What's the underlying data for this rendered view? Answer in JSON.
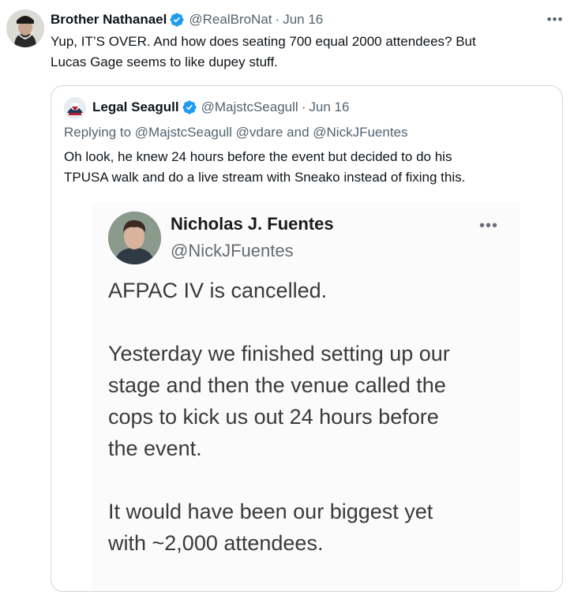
{
  "outer": {
    "author_name": "Brother Nathanael",
    "handle": "@RealBroNat",
    "separator": "·",
    "date": "Jun 16",
    "more_icon": "more-horizontal-icon",
    "text_line1": "Yup, IT’S OVER. And how  does seating 700 equal 2000 attendees? But",
    "text_line2": "Lucas Gage seems to like dupey stuff."
  },
  "quote": {
    "author_name": "Legal Seagull",
    "handle": "@MajstcSeagull",
    "separator": "·",
    "date": "Jun 16",
    "replying_prefix": "Replying to",
    "mention1": "@MajstcSeagull",
    "mention2": "@vdare",
    "mention_and": "and",
    "mention3": "@NickJFuentes",
    "text_line1": "Oh look, he knew 24 hours before the event but decided to do his",
    "text_line2": "TPUSA walk and do a live stream with Sneako instead of fixing this."
  },
  "screenshot": {
    "name": "Nicholas J. Fuentes",
    "handle": "@NickJFuentes",
    "more": "•••",
    "line1": "AFPAC IV is cancelled.",
    "line2": "Yesterday we finished setting up our",
    "line3": "stage and then the venue called the",
    "line4": "cops to kick us out 24 hours before",
    "line5": "the event.",
    "line6": "It would have been our biggest yet",
    "line7": "with ~2,000 attendees."
  },
  "colors": {
    "verified_blue": "#1d9bf0",
    "muted_text": "#536471",
    "border": "#cfd9de"
  }
}
